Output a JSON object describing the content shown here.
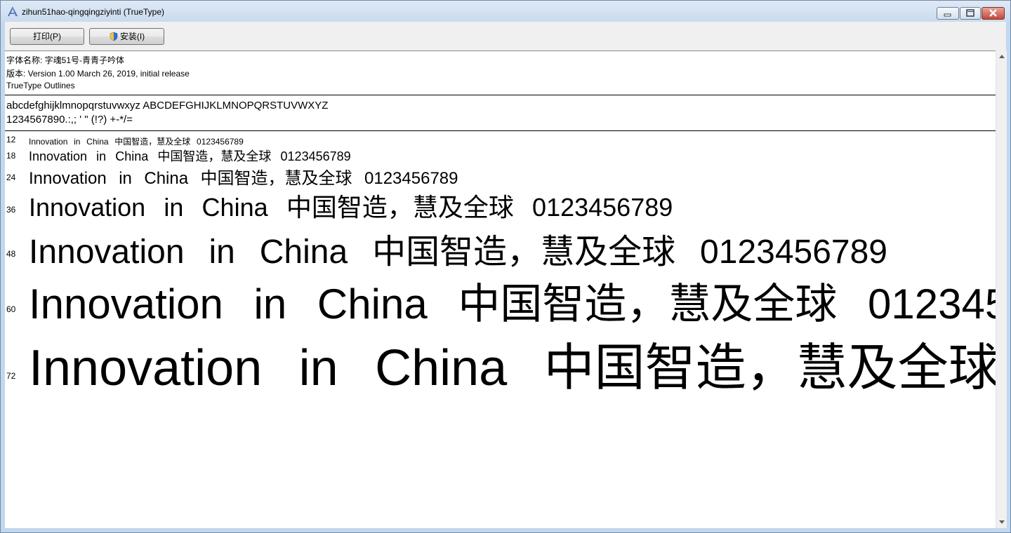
{
  "window": {
    "title": "zihun51hao-qingqingziyinti (TrueType)",
    "icon": "font-a-icon",
    "controls": [
      "minimize",
      "maximize",
      "close"
    ]
  },
  "toolbar": {
    "print_label": "打印(P)",
    "install_label": "安装(I)",
    "install_icon": "uac-shield-icon"
  },
  "font_info": {
    "name_line": "字体名称: 字魂51号-青青子吟体",
    "version_line": "版本: Version 1.00 March 26, 2019, initial release",
    "outline_line": "TrueType Outlines"
  },
  "charset": {
    "line1": "abcdefghijklmnopqrstuvwxyz   ABCDEFGHIJKLMNOPQRSTUVWXYZ",
    "line2": "1234567890.:,;  '  \"   (!?)   +-*/="
  },
  "sample": {
    "latin": "Innovation  in  China",
    "cjk": "中国智造，慧及全球",
    "digits": "0123456789"
  },
  "sizes": [
    {
      "size": "12"
    },
    {
      "size": "18"
    },
    {
      "size": "24"
    },
    {
      "size": "36"
    },
    {
      "size": "48"
    },
    {
      "size": "60"
    },
    {
      "size": "72"
    }
  ],
  "colors": {
    "titlebar": "#c9dbef",
    "content_bg": "#ffffff",
    "close_button": "#c7473a"
  }
}
